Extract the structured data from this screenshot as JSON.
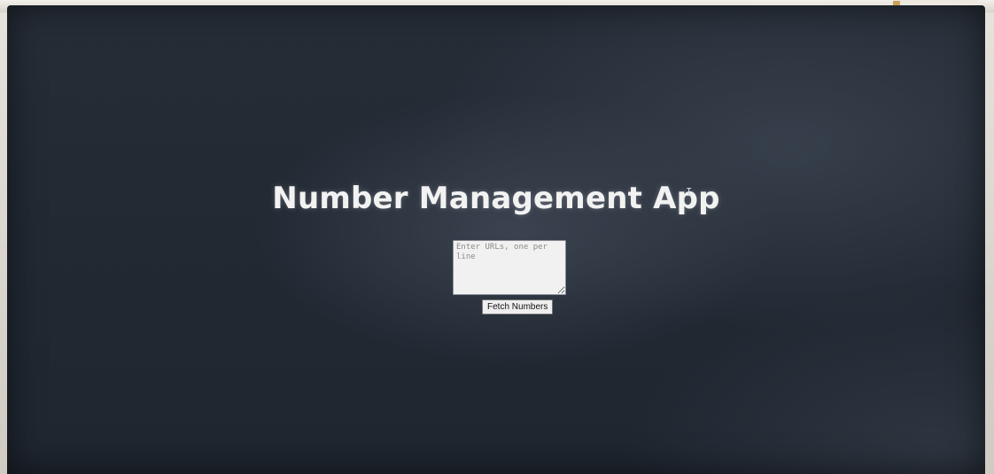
{
  "app": {
    "title": "Number Management App"
  },
  "urls_input": {
    "placeholder": "Enter URLs, one per line",
    "value": ""
  },
  "fetch_button": {
    "label": "Fetch Numbers"
  },
  "colors": {
    "background": "#232a34",
    "title_text": "#f2f2f2",
    "input_background": "#f1f1f1",
    "button_background": "#efefef"
  },
  "icons": {
    "cursor": "text-cursor-icon"
  }
}
